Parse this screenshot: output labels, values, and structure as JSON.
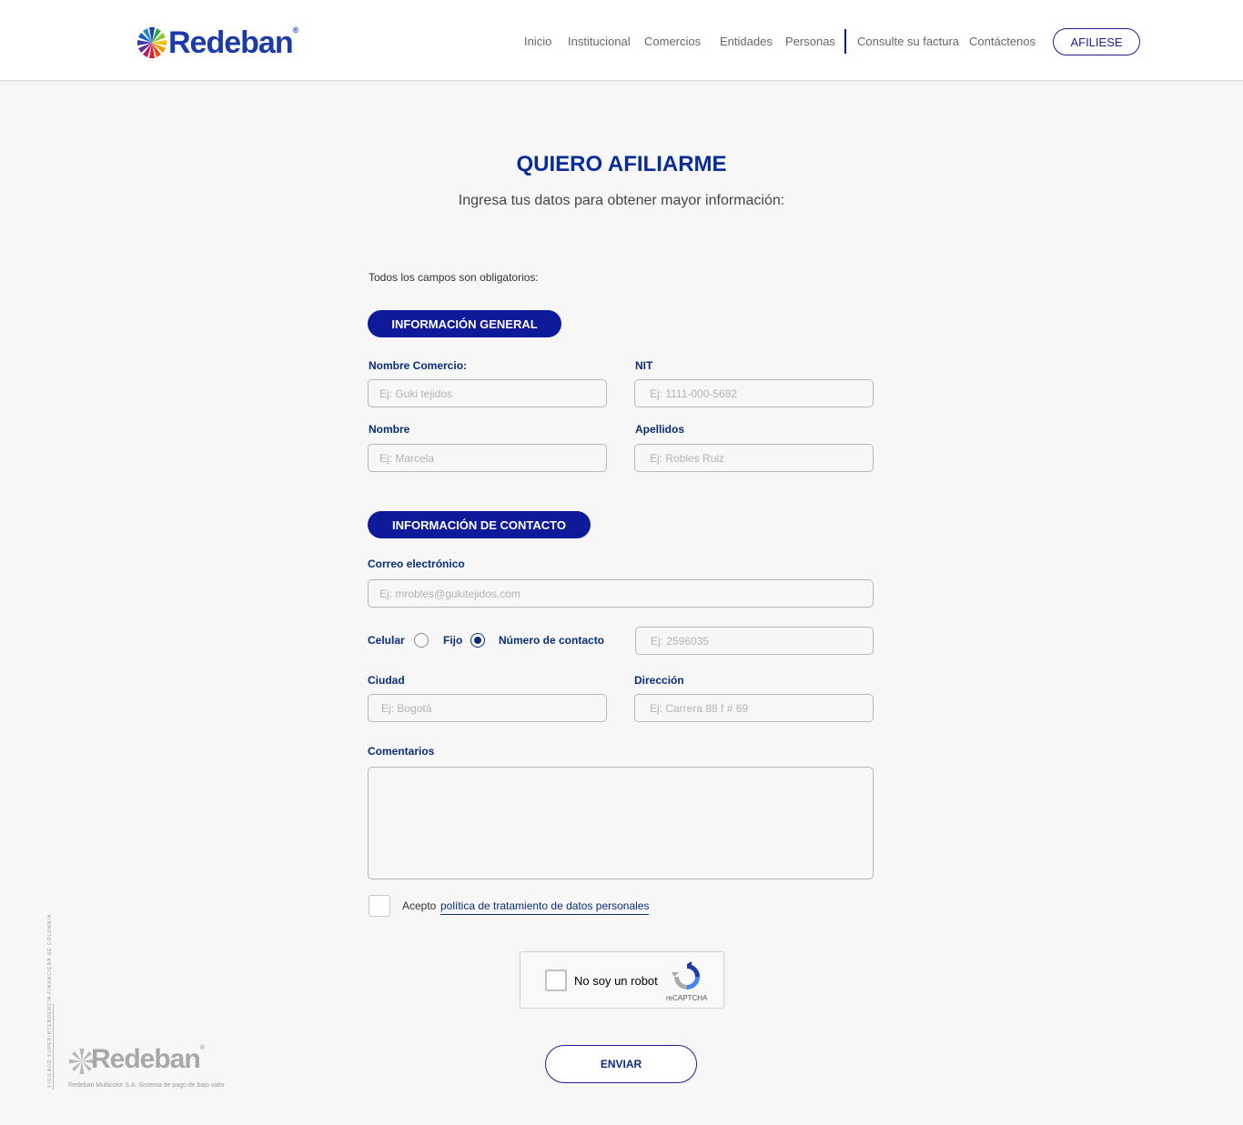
{
  "brand": {
    "name": "Redeban",
    "reg": "®"
  },
  "nav": {
    "items": [
      "Inicio",
      "Institucional",
      "Comercios",
      "Entidades",
      "Personas",
      "Consulte su factura",
      "Contáctenos"
    ],
    "cta": "AFILIESE"
  },
  "page": {
    "title": "QUIERO AFILIARME",
    "subtitle": "Ingresa tus datos para obtener mayor información:",
    "required_note": "Todos los campos son obligatorios:"
  },
  "sections": {
    "general": "INFORMACIÓN GENERAL",
    "contact": "INFORMACIÓN DE CONTACTO"
  },
  "fields": {
    "nombre_comercio": {
      "label": "Nombre Comercio:",
      "placeholder": "Ej: Guki tejidos"
    },
    "nit": {
      "label": "NIT",
      "placeholder": "Ej: 1111-000-5682"
    },
    "nombre": {
      "label": "Nombre",
      "placeholder": "Ej: Marcela"
    },
    "apellidos": {
      "label": "Apellidos",
      "placeholder": "Ej: Robles Ruiz"
    },
    "correo": {
      "label": "Correo electrónico",
      "placeholder": "Ej: mrobles@gukitejidos.com"
    },
    "phone_type": {
      "celular": "Celular",
      "fijo": "Fijo",
      "selected": "Fijo"
    },
    "numero": {
      "label": "Número de contacto",
      "placeholder": "Ej: 2596035"
    },
    "ciudad": {
      "label": "Ciudad",
      "placeholder": "Ej: Bogotá"
    },
    "direccion": {
      "label": "Dirección",
      "placeholder": "Ej: Carrera 88 f # 69"
    },
    "comentarios": {
      "label": "Comentarios",
      "placeholder": ""
    }
  },
  "consent": {
    "prefix": "Acepto",
    "link": "política de tratamiento de datos personales"
  },
  "captcha": {
    "label": "No soy un robot",
    "brand": "reCAPTCHA"
  },
  "submit": "ENVIAR",
  "footer": {
    "brand": "Redeban",
    "reg": "®",
    "tagline": "Redeban Multicolor S.A. Sistema de pago de bajo valor",
    "vigilado": "VIGILADO  SUPERINTENDENCIA FINANCIERA DE COLOMBIA"
  },
  "colors": {
    "primary": "#0e1a9a",
    "label": "#0a2c7a",
    "title": "#0a2c96",
    "background": "#f7f7f7"
  }
}
